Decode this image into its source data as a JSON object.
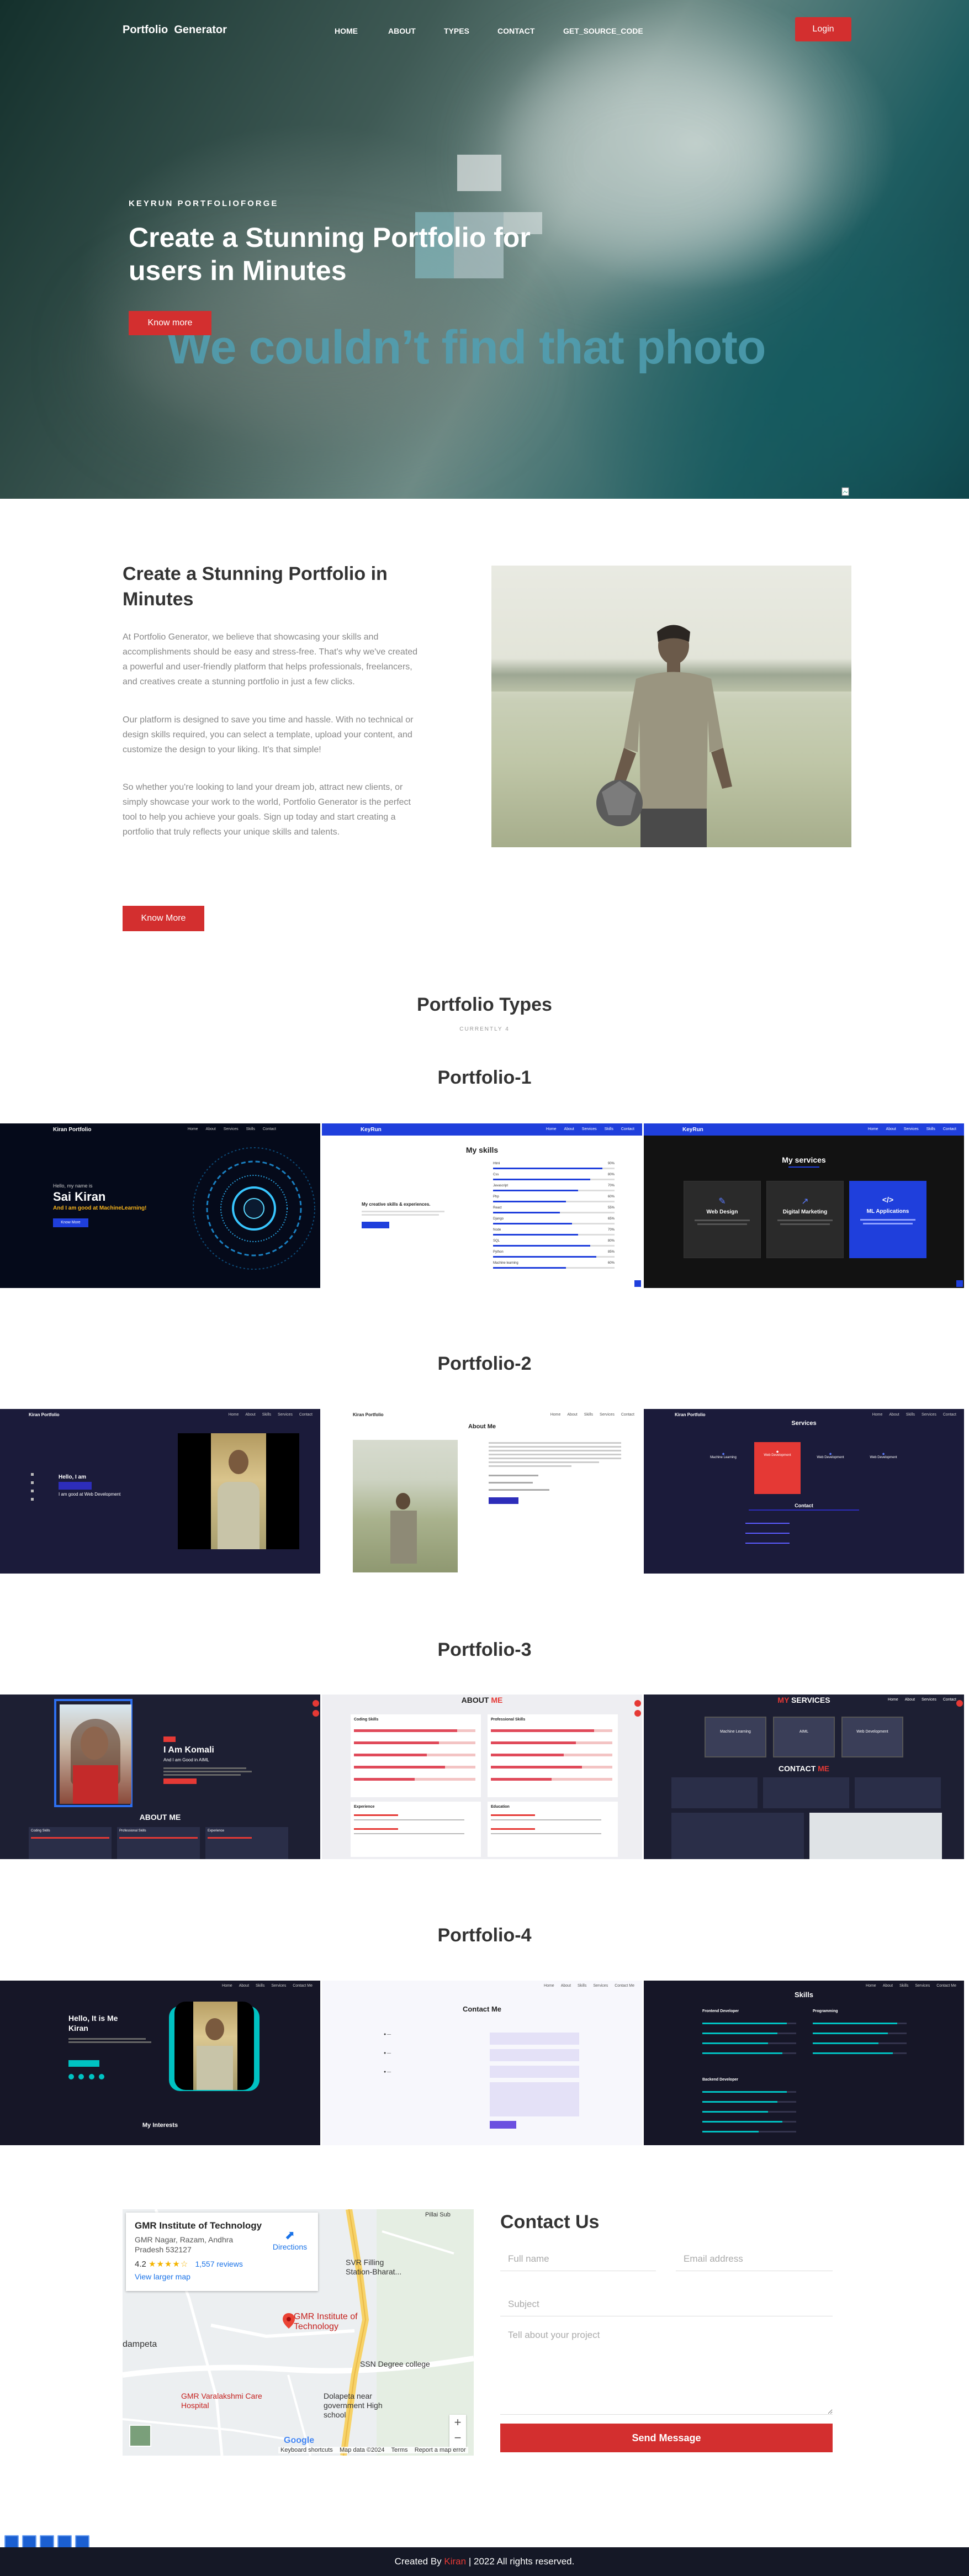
{
  "nav": {
    "logo": "Portfolio  Generator",
    "links": [
      "HOME",
      "ABOUT",
      "TYPES",
      "CONTACT",
      "GET_SOURCE_CODE"
    ],
    "login_label": "Login"
  },
  "hero": {
    "kicker": "KEYRUN PORTFOLIOFORGE",
    "title": "Create a Stunning Portfolio for users in Minutes",
    "button_label": "Know more",
    "missing_photo_text": "We couldn’t find that photo"
  },
  "about": {
    "title": "Create a Stunning Portfolio in Minutes",
    "paragraphs": [
      "At Portfolio Generator, we believe that showcasing your skills and accomplishments should be easy and stress-free. That's why we've created a powerful and user-friendly platform that helps professionals, freelancers, and creatives create a stunning portfolio in just a few clicks.",
      "Our platform is designed to save you time and hassle. With no technical or design skills required, you can select a template, upload your content, and customize the design to your liking. It's that simple!",
      "So whether you're looking to land your dream job, attract new clients, or simply showcase your work to the world, Portfolio Generator is the perfect tool to help you achieve your goals. Sign up today and start creating a portfolio that truly reflects your unique skills and talents."
    ],
    "button_label": "Know More"
  },
  "types": {
    "title": "Portfolio Types",
    "subtitle": "CURRENTLY 4",
    "portfolios": [
      "Portfolio-1",
      "Portfolio-2",
      "Portfolio-3",
      "Portfolio-4"
    ]
  },
  "p1": {
    "a_brand": "Kiran Portfolio",
    "a_hello": "Hello, my name is",
    "a_name": "Sai Kiran",
    "a_good": "And I am good at MachineLearning!",
    "a_button": "Know More",
    "nav_links": [
      "Home",
      "About",
      "Services",
      "Skills",
      "Contact"
    ],
    "b_brand": "KeyRun",
    "b_title": "My skills",
    "b_tag": "My creative skills & experiences.",
    "b_skills": [
      [
        "Html",
        90
      ],
      [
        "Css",
        80
      ],
      [
        "Javascript",
        70
      ],
      [
        "Php",
        60
      ],
      [
        "React",
        55
      ],
      [
        "Django",
        65
      ],
      [
        "Node",
        70
      ],
      [
        "SQL",
        80
      ],
      [
        "Python",
        85
      ],
      [
        "Machine learning",
        60
      ]
    ],
    "c_brand": "KeyRun",
    "c_title": "My services",
    "c_cards": [
      "Web Design",
      "Digital Marketing",
      "ML Applications"
    ]
  },
  "p2": {
    "brand": "Kiran Portfolio",
    "hello": "Hello, I am",
    "good": "I am good at Web Development",
    "about_title": "About Me",
    "services_title": "Services",
    "contact_title": "Contact",
    "service_cards": [
      "Machine Learning",
      "Web Development",
      "Web Development",
      "Web Development"
    ]
  },
  "p3": {
    "name": "I Am Komali",
    "role": "And I am Good in AIML",
    "about_title": "ABOUT ME",
    "services_title": "MY SERVICES",
    "contact_title": "CONTACT ME",
    "skills": [
      "Coding Skills",
      "Professional Skills"
    ],
    "experience": [
      "Experience",
      "Education"
    ],
    "services": [
      "Machine Learning",
      "AIML",
      "Web Development"
    ]
  },
  "p4": {
    "hello": "Hello, It is Me",
    "name": "Kiran",
    "interests": "My Interests",
    "contact_title": "Contact Me",
    "skills_title": "Skills",
    "skill_groups": [
      "Frontend Developer",
      "Programming",
      "Backend Developer"
    ]
  },
  "map": {
    "place": "GMR Institute of Technology",
    "address": "GMR Nagar, Razam, Andhra Pradesh 532127",
    "rating": "4.2",
    "stars": "★★★★☆",
    "reviews": "1,557 reviews",
    "view_larger": "View larger map",
    "directions": "Directions",
    "labels": {
      "pin1": "GMR Institute of Technology",
      "pin2": "GMR Varalakshmi Care Hospital",
      "pin3": "SVR Filling Station-Bharat...",
      "pin4": "SSN Degree college",
      "pin5": "Dolapeta near government High school",
      "town": "dampeta",
      "road": "Pillai Sub",
      "google": "Google",
      "shortcuts": "Keyboard shortcuts",
      "mapdata": "Map data ©2024",
      "terms": "Terms",
      "report": "Report a map error"
    }
  },
  "contact": {
    "title": "Contact Us",
    "name_placeholder": "Full name",
    "email_placeholder": "Email address",
    "subject_placeholder": "Subject",
    "message_placeholder": "Tell about your project",
    "send_label": "Send Message"
  },
  "footer": {
    "created_by": "Created By",
    "author": "Kiran",
    "separator": "|",
    "rights": "2022 All rights reserved."
  },
  "colors": {
    "accent": "#d32f2f",
    "dark_bg": "#151826",
    "portfolio_blue": "#1f3fdc"
  }
}
